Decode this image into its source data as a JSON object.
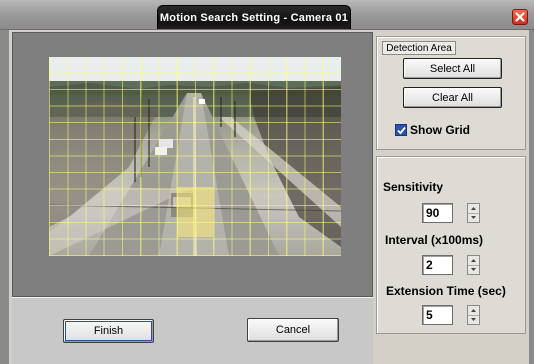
{
  "window": {
    "title": "Motion Search Setting - Camera 01"
  },
  "icons": {
    "close": "close-icon",
    "checkmark": "checkmark-icon",
    "spin_up": "arrow-up-icon",
    "spin_down": "arrow-down-icon"
  },
  "colors": {
    "title_bg": "#111111",
    "close_bg": "#d8432c",
    "grid_line": "#ffff78",
    "checkbox": "#2b54b0"
  },
  "footer": {
    "finish_label": "Finish",
    "cancel_label": "Cancel"
  },
  "detection_area": {
    "title": "Detection Area",
    "select_all_label": "Select All",
    "clear_all_label": "Clear All",
    "show_grid_label": "Show Grid",
    "show_grid_checked": true
  },
  "settings": {
    "sensitivity_label": "Sensitivity",
    "sensitivity_value": "90",
    "interval_label": "Interval (x100ms)",
    "interval_value": "2",
    "extension_label": "Extension Time (sec)",
    "extension_value": "5"
  }
}
